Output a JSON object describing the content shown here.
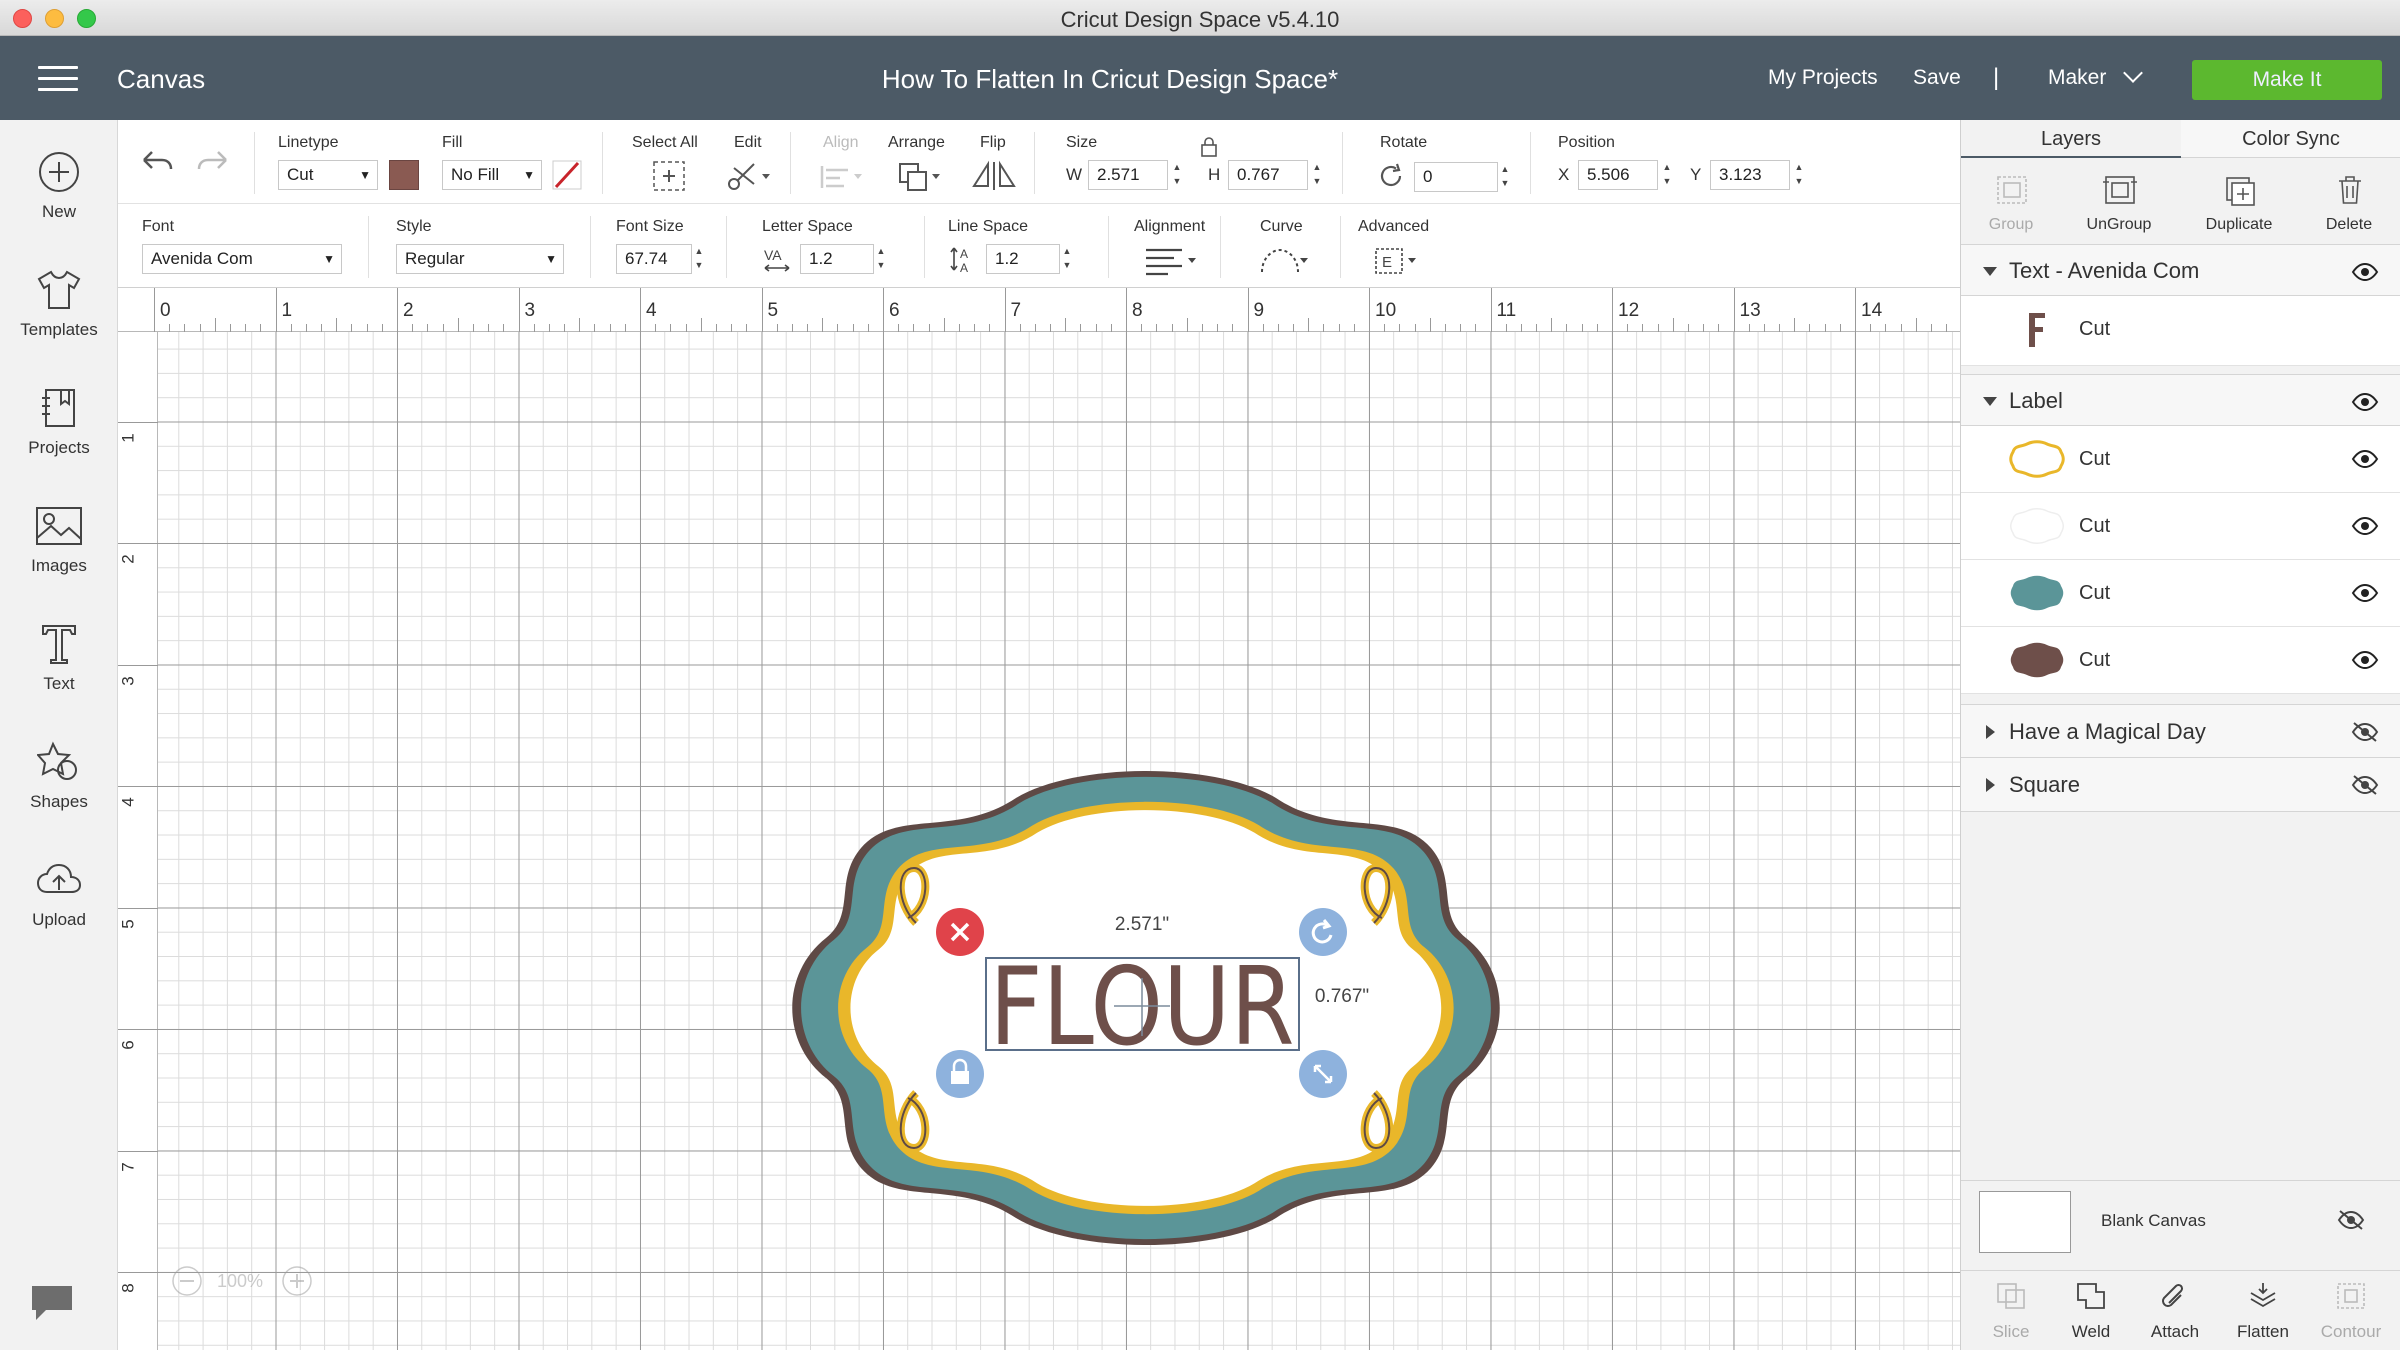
{
  "window": {
    "title": "Cricut Design Space  v5.4.10"
  },
  "header": {
    "section": "Canvas",
    "doc_title": "How To Flatten In Cricut Design Space*",
    "my_projects": "My Projects",
    "save": "Save",
    "separator": "|",
    "machine": "Maker",
    "make_it": "Make It"
  },
  "sidebar": {
    "items": [
      {
        "label": "New",
        "icon": "plus-circle-icon"
      },
      {
        "label": "Templates",
        "icon": "tshirt-icon"
      },
      {
        "label": "Projects",
        "icon": "notebook-icon"
      },
      {
        "label": "Images",
        "icon": "image-icon"
      },
      {
        "label": "Text",
        "icon": "text-t-icon"
      },
      {
        "label": "Shapes",
        "icon": "shapes-icon"
      },
      {
        "label": "Upload",
        "icon": "cloud-upload-icon"
      }
    ]
  },
  "toolbar": {
    "linetype_label": "Linetype",
    "linetype_value": "Cut",
    "fill_label": "Fill",
    "fill_value": "No Fill",
    "select_all": "Select All",
    "edit": "Edit",
    "align": "Align",
    "arrange": "Arrange",
    "flip": "Flip",
    "size_label": "Size",
    "w_label": "W",
    "w_value": "2.571",
    "h_label": "H",
    "h_value": "0.767",
    "rotate_label": "Rotate",
    "rotate_value": "0",
    "position_label": "Position",
    "x_label": "X",
    "x_value": "5.506",
    "y_label": "Y",
    "y_value": "3.123",
    "swatch_color": "#8a5a52"
  },
  "text_toolbar": {
    "font_label": "Font",
    "font_value": "Avenida Com",
    "style_label": "Style",
    "style_value": "Regular",
    "font_size_label": "Font Size",
    "font_size_value": "67.74",
    "letter_space_label": "Letter Space",
    "letter_space_value": "1.2",
    "line_space_label": "Line Space",
    "line_space_value": "1.2",
    "alignment_label": "Alignment",
    "curve_label": "Curve",
    "advanced_label": "Advanced"
  },
  "ruler": {
    "top": [
      "0",
      "1",
      "2",
      "3",
      "4",
      "5",
      "6",
      "7",
      "8",
      "9",
      "10",
      "11",
      "12",
      "13",
      "14"
    ],
    "left": [
      "1",
      "2",
      "3",
      "4",
      "5",
      "6",
      "7",
      "8"
    ]
  },
  "canvas": {
    "text": "FLOUR",
    "width_readout": "2.571\"",
    "height_readout": "0.767\"",
    "zoom": "100%"
  },
  "colors": {
    "teal": "#5b9598",
    "gold": "#e9b72a",
    "brown": "#6e4f4a",
    "make_it": "#5cb82f",
    "header": "#4c5a66"
  },
  "panel": {
    "tabs": [
      "Layers",
      "Color Sync"
    ],
    "buttons": [
      "Group",
      "UnGroup",
      "Duplicate",
      "Delete"
    ],
    "groups": [
      {
        "title": "Text - Avenida Com",
        "layers": [
          {
            "label": "Cut",
            "color": "#6e4f4a"
          }
        ]
      },
      {
        "title": "Label",
        "layers": [
          {
            "label": "Cut",
            "color": "#e9b72a"
          },
          {
            "label": "Cut",
            "color": "#ffffff"
          },
          {
            "label": "Cut",
            "color": "#5b9598"
          },
          {
            "label": "Cut",
            "color": "#6e4f4a"
          }
        ]
      },
      {
        "title": "Have a Magical Day"
      },
      {
        "title": "Square"
      }
    ],
    "blank_canvas": "Blank Canvas",
    "bottom_buttons": [
      "Slice",
      "Weld",
      "Attach",
      "Flatten",
      "Contour"
    ]
  }
}
